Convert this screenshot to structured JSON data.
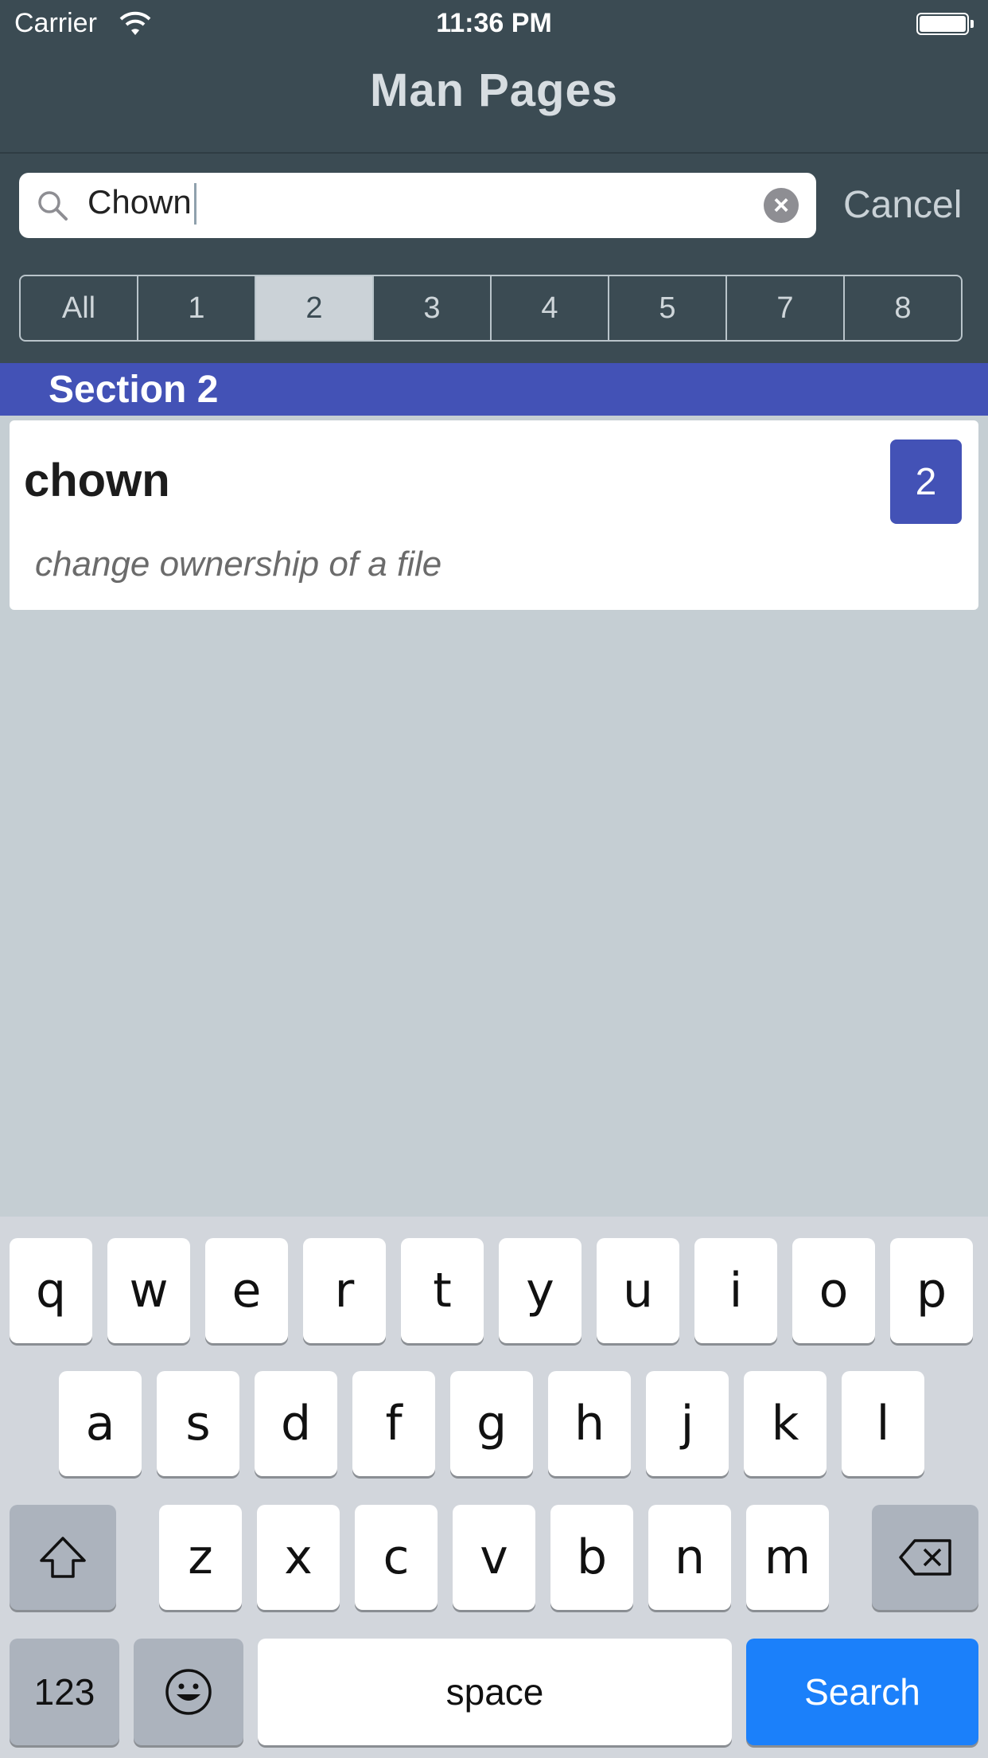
{
  "status": {
    "carrier": "Carrier",
    "time": "11:36 PM"
  },
  "nav": {
    "title": "Man Pages"
  },
  "search": {
    "value": "Chown",
    "cancel_label": "Cancel"
  },
  "segments": [
    "All",
    "1",
    "2",
    "3",
    "4",
    "5",
    "7",
    "8"
  ],
  "selected_segment": "2",
  "section": {
    "title": "Section 2"
  },
  "result": {
    "name": "chown",
    "description": "change ownership of a file",
    "section_badge": "2"
  },
  "keyboard": {
    "row1": [
      "q",
      "w",
      "e",
      "r",
      "t",
      "y",
      "u",
      "i",
      "o",
      "p"
    ],
    "row2": [
      "a",
      "s",
      "d",
      "f",
      "g",
      "h",
      "j",
      "k",
      "l"
    ],
    "row3": [
      "z",
      "x",
      "c",
      "v",
      "b",
      "n",
      "m"
    ],
    "numbers_label": "123",
    "space_label": "space",
    "search_label": "Search"
  },
  "colors": {
    "nav_bg": "#3b4b53",
    "section_bg": "#4352b6",
    "search_key": "#1b80fa"
  }
}
